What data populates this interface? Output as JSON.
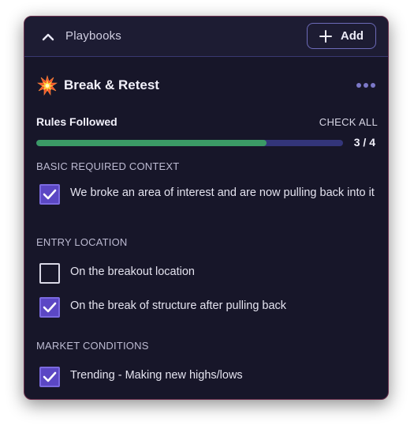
{
  "header": {
    "title": "Playbooks",
    "add_label": "Add",
    "collapse_icon": "chevron-up-icon",
    "add_icon": "plus-icon"
  },
  "playbook": {
    "icon": "explosion-icon",
    "name": "Break & Retest",
    "more_icon": "more-horizontal-icon"
  },
  "progress": {
    "label": "Rules Followed",
    "check_all_label": "CHECK ALL",
    "count_text": "3 / 4",
    "completed": 3,
    "total": 4,
    "fill_color": "#3b9a66",
    "track_color": "#33357a"
  },
  "sections": [
    {
      "heading": "BASIC REQUIRED CONTEXT",
      "rules": [
        {
          "text": "We broke an area of interest and are now pulling back into it",
          "checked": true
        }
      ]
    },
    {
      "heading": "ENTRY LOCATION",
      "rules": [
        {
          "text": "On the breakout location",
          "checked": false
        },
        {
          "text": "On the break of structure after pulling back",
          "checked": true
        }
      ]
    },
    {
      "heading": "MARKET CONDITIONS",
      "rules": [
        {
          "text": "Trending - Making new highs/lows",
          "checked": true
        }
      ]
    }
  ],
  "colors": {
    "panel_bg": "#171629",
    "accent_purple": "#5b47c4",
    "progress_green": "#3b9a66"
  }
}
